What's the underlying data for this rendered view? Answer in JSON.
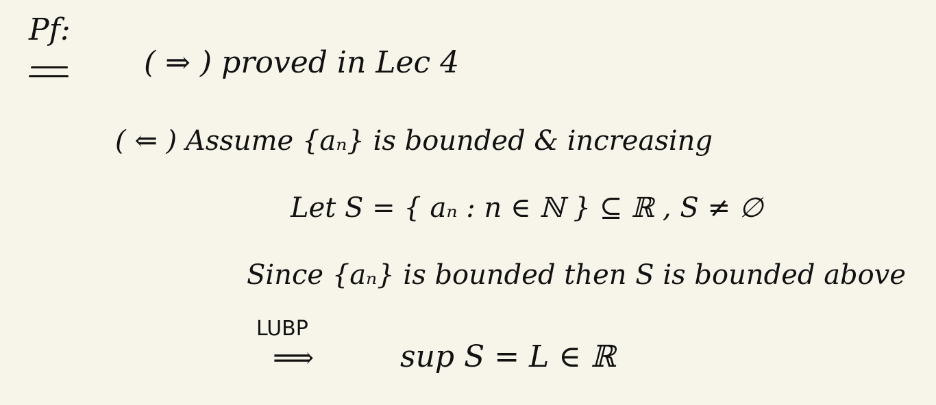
{
  "note": {
    "pf_label": "Pf:",
    "line1": "( ⇒ ) proved in Lec 4",
    "line2": "( ⇐ ) Assume {aₙ} is bounded & increasing",
    "line3": "Let  S = { aₙ : n ∈ ℕ } ⊆ ℝ ,  S ≠ ∅",
    "line4": "Since {aₙ} is bounded then S is bounded above",
    "lubp_label": "LUBP",
    "implies": "⟹",
    "line5": "sup S = L ∈ ℝ"
  }
}
